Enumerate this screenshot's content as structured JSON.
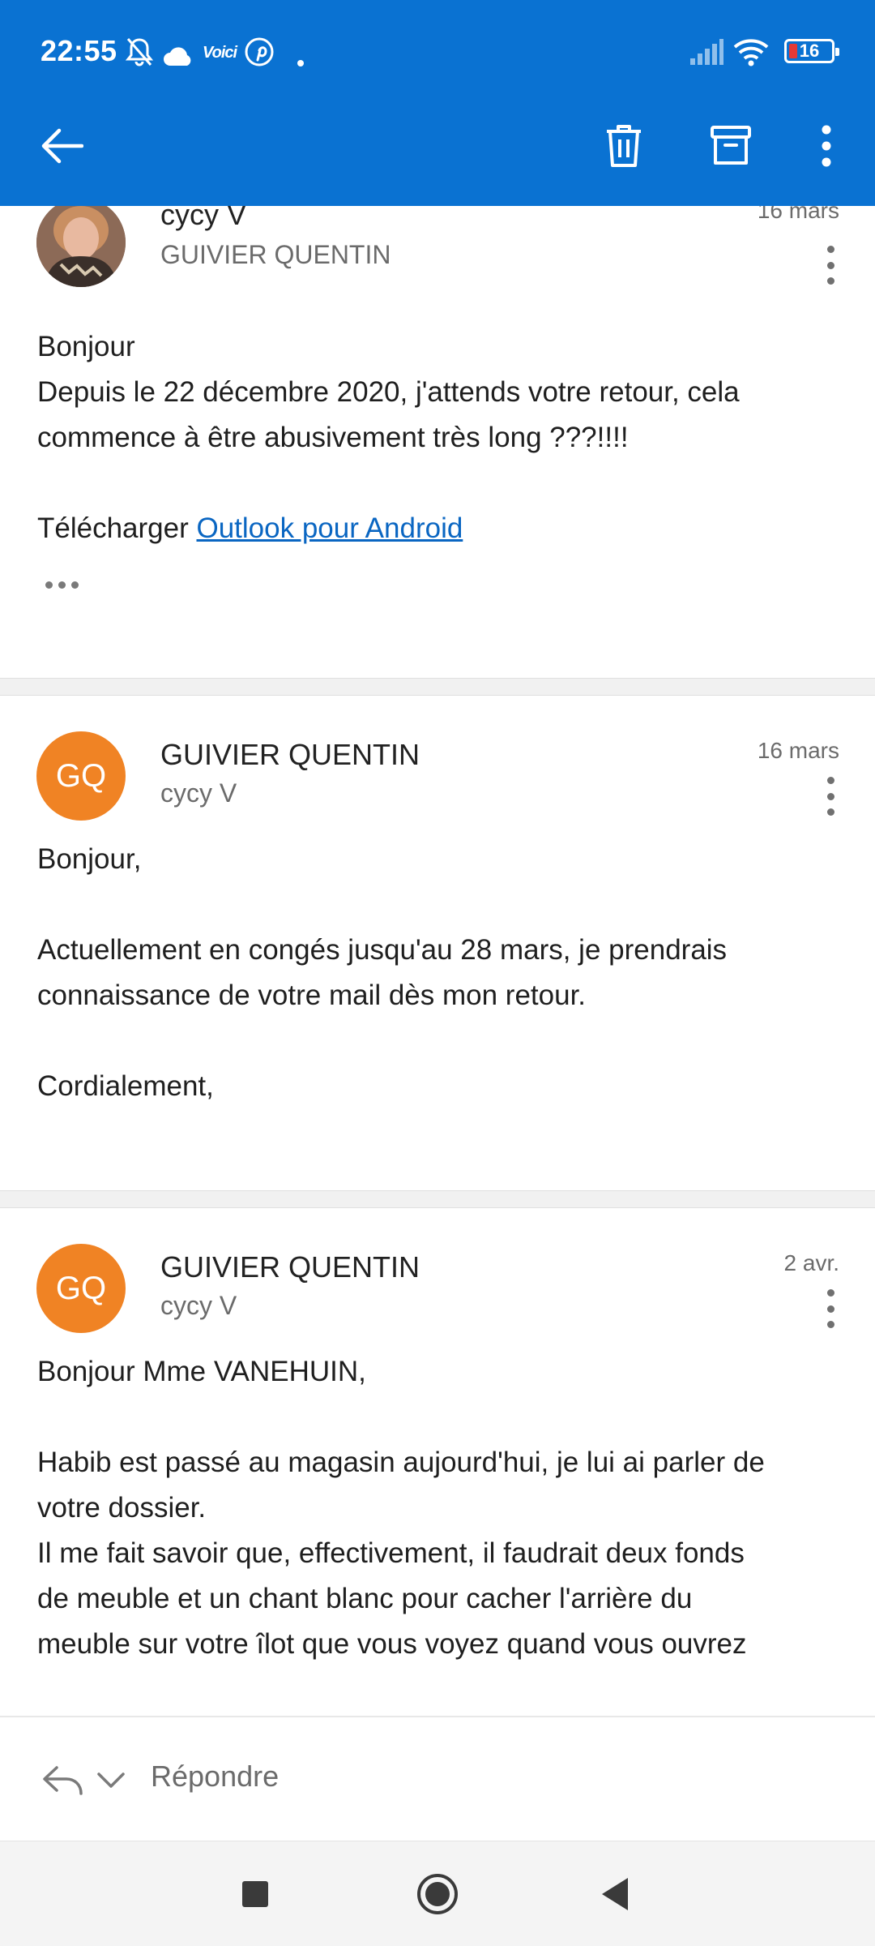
{
  "status_bar": {
    "time": "22:55",
    "battery": "16",
    "icons": [
      "mute-bell-icon",
      "cloud-icon",
      "voici-icon",
      "pinterest-icon",
      "dot-icon",
      "signal-icon",
      "wifi-icon",
      "battery-icon"
    ],
    "carrier_badge": "Voici"
  },
  "app_bar": {
    "color": "#0a72d2",
    "back_icon": "arrow-left-icon",
    "actions": [
      "trash-icon",
      "archive-icon",
      "more-vertical-icon"
    ]
  },
  "messages": [
    {
      "sender": "cycy V",
      "recipient": "GUIVIER QUENTIN",
      "date": "16 mars",
      "avatar": "photo",
      "body": [
        "Bonjour",
        "Depuis le 22 décembre 2020, j'attends votre retour, cela",
        "commence à être abusivement très long ???!!!!"
      ],
      "download_prefix": "Télécharger ",
      "download_link": "Outlook pour Android"
    },
    {
      "sender": "GUIVIER QUENTIN",
      "recipient": "cycy V",
      "date": "16 mars",
      "avatar_initials": "GQ",
      "avatar_color": "#f08324",
      "body": [
        "Bonjour,",
        "",
        "Actuellement en congés jusqu'au 28 mars, je prendrais",
        "connaissance de votre mail dès mon retour.",
        "",
        "Cordialement,"
      ]
    },
    {
      "sender": "GUIVIER QUENTIN",
      "recipient": "cycy V",
      "date": "2 avr.",
      "avatar_initials": "GQ",
      "avatar_color": "#f08324",
      "body": [
        "Bonjour Mme VANEHUIN,",
        "",
        "Habib est passé au magasin aujourd'hui, je lui ai parler de",
        "votre dossier.",
        "Il me fait savoir que, effectivement, il faudrait deux fonds",
        "de meuble et un chant blanc pour cacher l'arrière du",
        "meuble sur votre îlot que vous voyez quand vous ouvrez"
      ]
    }
  ],
  "reply_bar": {
    "label": "Répondre",
    "icons": [
      "reply-icon",
      "chevron-down-icon"
    ]
  },
  "nav_bar": {
    "icons": [
      "recents-square-icon",
      "home-circle-icon",
      "back-triangle-icon"
    ]
  }
}
